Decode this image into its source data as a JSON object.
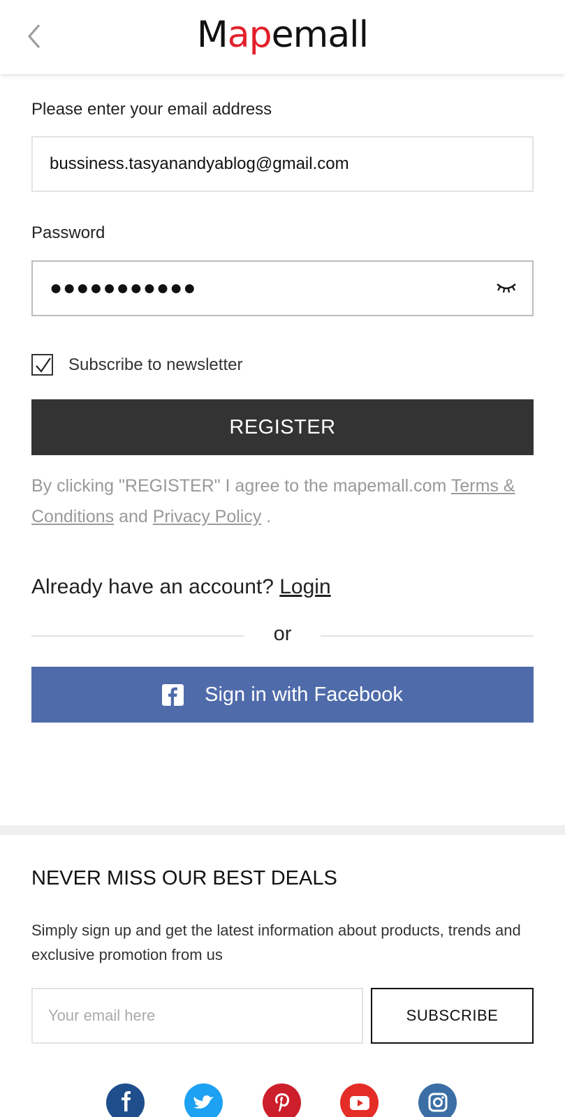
{
  "header": {
    "logo_pre": "M",
    "logo_accent": "ap",
    "logo_post": "emall",
    "back_icon": "chevron-left-icon"
  },
  "form": {
    "email_label": "Please enter your email address",
    "email_value": "bussiness.tasyanandyablog@gmail.com",
    "password_label": "Password",
    "password_value": "●●●●●●●●●●●",
    "eye_icon": "eye-closed-icon",
    "newsletter_label": "Subscribe to newsletter",
    "newsletter_checked": true,
    "register_label": "REGISTER"
  },
  "terms": {
    "prefix": "By clicking \"REGISTER\" I agree to the mapemall.com ",
    "terms_link": "Terms & Conditions",
    "middle": " and ",
    "privacy_link": "Privacy Policy",
    "suffix": " ."
  },
  "login": {
    "prompt": "Already have an account? ",
    "link": "Login",
    "or": "or",
    "facebook_label": "Sign in with Facebook"
  },
  "newsletter": {
    "title": "NEVER MISS OUR BEST DEALS",
    "description": "Simply sign up and get the latest information about products, trends and exclusive promotion from us",
    "placeholder": "Your email here",
    "button": "SUBSCRIBE"
  },
  "social": [
    {
      "name": "facebook-icon",
      "color": "#1f4e8c"
    },
    {
      "name": "twitter-icon",
      "color": "#1da1f2"
    },
    {
      "name": "pinterest-icon",
      "color": "#cc1f2b"
    },
    {
      "name": "youtube-icon",
      "color": "#e52d27"
    },
    {
      "name": "instagram-icon",
      "color": "#3b6ea5"
    }
  ],
  "colors": {
    "register_bg": "#333333",
    "facebook_bg": "#4f6baa",
    "logo_accent": "#e2202b"
  }
}
